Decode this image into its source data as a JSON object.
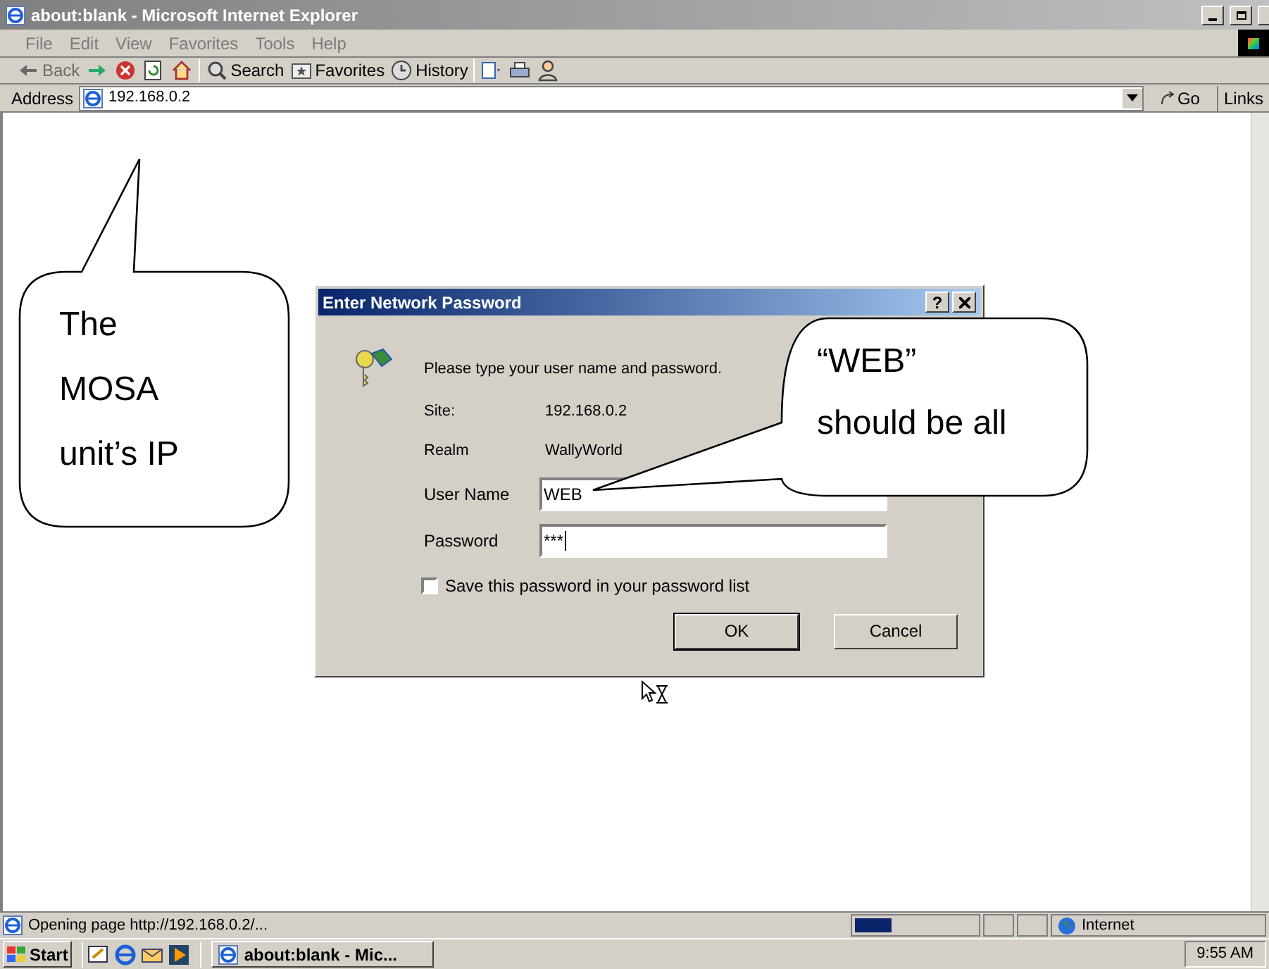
{
  "window": {
    "title": "about:blank - Microsoft Internet Explorer"
  },
  "menu": [
    {
      "label": "File"
    },
    {
      "label": "Edit"
    },
    {
      "label": "View"
    },
    {
      "label": "Favorites"
    },
    {
      "label": "Tools"
    },
    {
      "label": "Help"
    }
  ],
  "toolbar": [
    {
      "kind": "back",
      "label": "Back",
      "disabled": true
    },
    {
      "kind": "forward",
      "disabled": false
    },
    {
      "kind": "stop",
      "disabled": false
    },
    {
      "kind": "refresh",
      "disabled": false
    },
    {
      "kind": "home",
      "disabled": false
    },
    {
      "kind": "search",
      "label": "Search",
      "disabled": false
    },
    {
      "kind": "favorites",
      "label": "Favorites",
      "disabled": false
    },
    {
      "kind": "history",
      "label": "History",
      "disabled": false
    },
    {
      "kind": "mail",
      "disabled": false
    },
    {
      "kind": "print",
      "disabled": false
    },
    {
      "kind": "messenger",
      "disabled": false
    }
  ],
  "address": {
    "label": "Address",
    "value": "192.168.0.2",
    "go": "Go",
    "links": "Links"
  },
  "dialog": {
    "title": "Enter Network Password",
    "help": "?",
    "prompt": "Please type your user name and password.",
    "fields": [
      {
        "label": "Site:",
        "value": "192.168.0.2"
      },
      {
        "label": "Realm",
        "value": "WallyWorld"
      }
    ],
    "inputs": [
      {
        "label": "User Name",
        "value": "WEB"
      },
      {
        "label": "Password",
        "value": "***"
      }
    ],
    "save": {
      "label": "Save this password in your password list",
      "checked": false
    },
    "buttons": [
      {
        "label": "OK",
        "default": true
      },
      {
        "label": "Cancel",
        "default": false
      }
    ]
  },
  "callouts": [
    {
      "lines": [
        "The",
        "MOSA",
        "unit’s IP"
      ]
    },
    {
      "lines": [
        "“WEB”",
        "should be all"
      ]
    }
  ],
  "status_bar": {
    "text": "Opening page http://192.168.0.2/...",
    "progress": {
      "level": 0.3
    },
    "zone": "Internet"
  },
  "taskbar": {
    "start": "Start",
    "tasks": [
      {
        "label": "about:blank - Mic...",
        "selected": false
      }
    ],
    "clock": "9:55 AM"
  }
}
